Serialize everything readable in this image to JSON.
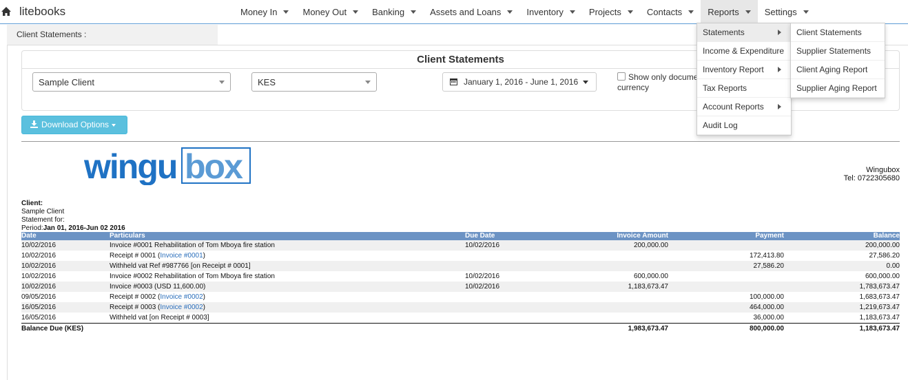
{
  "app": {
    "brand": "litebooks"
  },
  "nav": [
    {
      "label": "Money In",
      "name": "nav-money-in"
    },
    {
      "label": "Money Out",
      "name": "nav-money-out"
    },
    {
      "label": "Banking",
      "name": "nav-banking"
    },
    {
      "label": "Assets and Loans",
      "name": "nav-assets-loans"
    },
    {
      "label": "Inventory",
      "name": "nav-inventory"
    },
    {
      "label": "Projects",
      "name": "nav-projects"
    },
    {
      "label": "Contacts",
      "name": "nav-contacts"
    },
    {
      "label": "Reports",
      "name": "nav-reports"
    },
    {
      "label": "Settings",
      "name": "nav-settings"
    }
  ],
  "breadcrumb": "Client Statements :",
  "panel": {
    "title": "Client Statements",
    "client_select": "Sample Client",
    "currency_select": "KES",
    "date_range": "January 1, 2016 - June 1, 2016",
    "checkbox_label": "Show only document currency",
    "checkbox_line1": "Show only docume",
    "checkbox_line2": "currency"
  },
  "download_button": "Download Options",
  "company": {
    "name": "Wingubox",
    "tel": "Tel: 0722305680",
    "logo_a": "wingu",
    "logo_b": "box"
  },
  "client_info": {
    "client_label": "Client:",
    "client_name": "Sample Client",
    "statement_for": "Statement for:",
    "period_label": "Period:",
    "period_value": "Jan 01, 2016-Jun 02 2016"
  },
  "table": {
    "headers": [
      "Date",
      "Particulars",
      "Due Date",
      "Invoice Amount",
      "Payment",
      "Balance"
    ],
    "rows": [
      {
        "date": "10/02/2016",
        "particulars": "Invoice #0001 Rehabilitation of Tom Mboya fire station",
        "link": "",
        "due": "10/02/2016",
        "invoice": "200,000.00",
        "payment": "",
        "balance": "200,000.00"
      },
      {
        "date": "10/02/2016",
        "particulars": "Receipt # 0001 (",
        "link": "Invoice #0001",
        "due": "",
        "invoice": "",
        "payment": "172,413.80",
        "balance": "27,586.20"
      },
      {
        "date": "10/02/2016",
        "particulars": "Withheld vat Ref #987766 [on Receipt # 0001]",
        "link": "",
        "due": "",
        "invoice": "",
        "payment": "27,586.20",
        "balance": "0.00"
      },
      {
        "date": "10/02/2016",
        "particulars": "Invoice #0002 Rehabilitation of Tom Mboya fire station",
        "link": "",
        "due": "10/02/2016",
        "invoice": "600,000.00",
        "payment": "",
        "balance": "600,000.00"
      },
      {
        "date": "10/02/2016",
        "particulars": "Invoice #0003 (USD 11,600.00)",
        "link": "",
        "due": "10/02/2016",
        "invoice": "1,183,673.47",
        "payment": "",
        "balance": "1,783,673.47"
      },
      {
        "date": "09/05/2016",
        "particulars": "Receipt # 0002 (",
        "link": "Invoice #0002",
        "due": "",
        "invoice": "",
        "payment": "100,000.00",
        "balance": "1,683,673.47"
      },
      {
        "date": "16/05/2016",
        "particulars": "Receipt # 0003 (",
        "link": "Invoice #0002",
        "due": "",
        "invoice": "",
        "payment": "464,000.00",
        "balance": "1,219,673.47"
      },
      {
        "date": "16/05/2016",
        "particulars": "Withheld vat [on Receipt # 0003]",
        "link": "",
        "due": "",
        "invoice": "",
        "payment": "36,000.00",
        "balance": "1,183,673.47"
      }
    ],
    "total": {
      "label": "Balance Due (KES)",
      "invoice": "1,983,673.47",
      "payment": "800,000.00",
      "balance": "1,183,673.47"
    }
  },
  "reports_menu": [
    {
      "label": "Statements",
      "submenu": true
    },
    {
      "label": "Income & Expenditure",
      "submenu": false
    },
    {
      "label": "Inventory Report",
      "submenu": true
    },
    {
      "label": "Tax Reports",
      "submenu": false
    },
    {
      "label": "Account Reports",
      "submenu": true
    },
    {
      "label": "Audit Log",
      "submenu": false
    }
  ],
  "statements_submenu": [
    "Client Statements",
    "Supplier Statements",
    "Client Aging Report",
    "Supplier Aging Report"
  ],
  "colors": {
    "accent": "#5bc0de",
    "table_header": "#6c93c4",
    "logo_blue": "#1f72c4",
    "link": "#2a6ebb"
  }
}
